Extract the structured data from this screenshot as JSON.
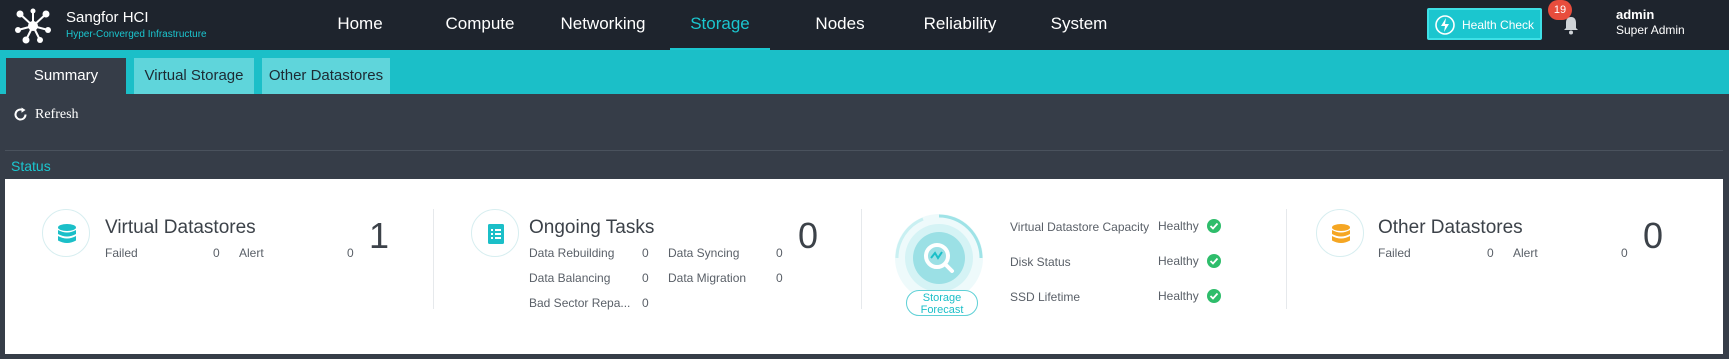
{
  "brand": {
    "name": "Sangfor HCI",
    "subtitle": "Hyper-Converged Infrastructure"
  },
  "nav": {
    "items": [
      {
        "label": "Home"
      },
      {
        "label": "Compute"
      },
      {
        "label": "Networking"
      },
      {
        "label": "Storage"
      },
      {
        "label": "Nodes"
      },
      {
        "label": "Reliability"
      },
      {
        "label": "System"
      }
    ],
    "active": "Storage"
  },
  "header": {
    "health_check_label": "Health Check",
    "notification_count": "19",
    "user_name": "admin",
    "user_role": "Super Admin"
  },
  "tabs": [
    {
      "label": "Summary"
    },
    {
      "label": "Virtual Storage"
    },
    {
      "label": "Other Datastores"
    }
  ],
  "toolbar": {
    "refresh_label": "Refresh"
  },
  "status": {
    "title": "Status",
    "virtual_datastores": {
      "title": "Virtual Datastores",
      "count": "1",
      "failed_label": "Failed",
      "failed_value": "0",
      "alert_label": "Alert",
      "alert_value": "0"
    },
    "ongoing_tasks": {
      "title": "Ongoing Tasks",
      "count": "0",
      "items": [
        {
          "label": "Data Rebuilding",
          "value": "0"
        },
        {
          "label": "Data Syncing",
          "value": "0"
        },
        {
          "label": "Data Balancing",
          "value": "0"
        },
        {
          "label": "Data Migration",
          "value": "0"
        },
        {
          "label": "Bad Sector Repa...",
          "value": "0"
        }
      ]
    },
    "forecast": {
      "label_line1": "Storage",
      "label_line2": "Forecast",
      "checks": [
        {
          "label": "Virtual Datastore Capacity",
          "value": "Healthy"
        },
        {
          "label": "Disk Status",
          "value": "Healthy"
        },
        {
          "label": "SSD Lifetime",
          "value": "Healthy"
        }
      ]
    },
    "other_datastores": {
      "title": "Other Datastores",
      "count": "0",
      "failed_label": "Failed",
      "failed_value": "0",
      "alert_label": "Alert",
      "alert_value": "0"
    }
  },
  "colors": {
    "accent": "#1bc6cf",
    "topbar": "#1e242d",
    "healthy": "#2ebd6b",
    "warning": "#f5a623"
  },
  "icons": [
    "sangfor-logo-icon",
    "health-check-icon",
    "bell-icon",
    "refresh-icon",
    "database-icon",
    "task-list-icon",
    "storage-forecast-icon",
    "check-circle-icon"
  ]
}
